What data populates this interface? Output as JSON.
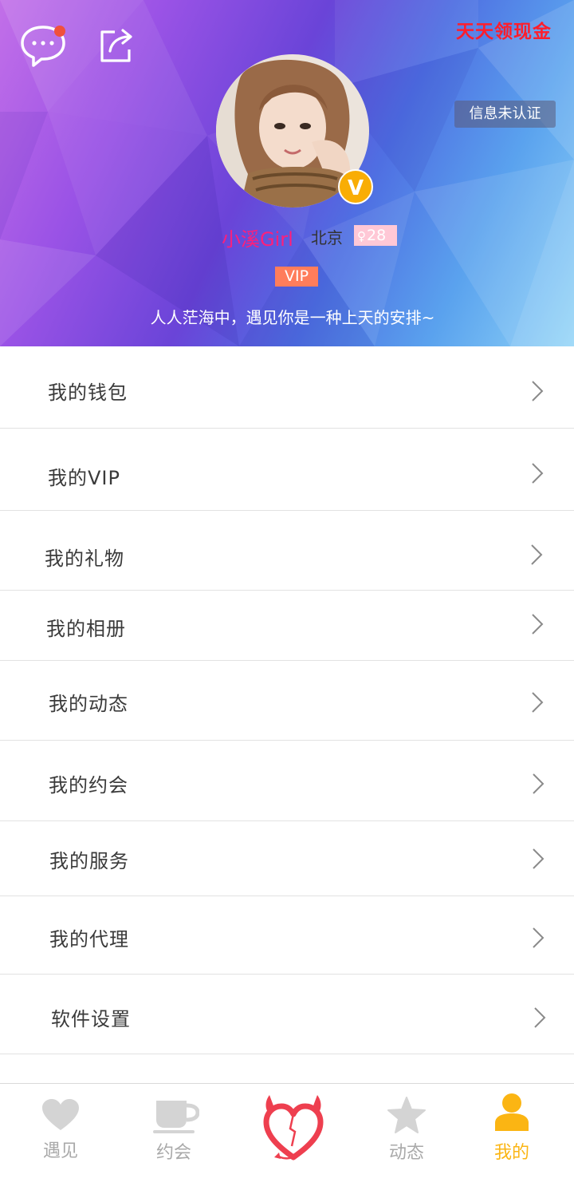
{
  "header": {
    "cash_link": "天天领现金",
    "unverified_badge": "信息未认证",
    "profile": {
      "name": "小溪Girl",
      "city": "北京",
      "gender_symbol": "♀",
      "age": "28",
      "vip_tag": "VIP",
      "verified_badge": "V",
      "bio": "人人茫海中，遇见你是一种上天的安排~"
    }
  },
  "menu": {
    "items": [
      {
        "label": "我的钱包"
      },
      {
        "label": "我的VIP"
      },
      {
        "label": "我的礼物"
      },
      {
        "label": "我的相册"
      },
      {
        "label": "我的动态"
      },
      {
        "label": "我的约会"
      },
      {
        "label": "我的服务"
      },
      {
        "label": "我的代理"
      },
      {
        "label": "软件设置"
      }
    ]
  },
  "tabbar": {
    "tabs": [
      {
        "label": "遇见",
        "icon": "heart-icon"
      },
      {
        "label": "约会",
        "icon": "coffee-cup-icon"
      },
      {
        "label": "",
        "icon": "devil-heart-icon"
      },
      {
        "label": "动态",
        "icon": "star-icon"
      },
      {
        "label": "我的",
        "icon": "person-icon",
        "active": true
      }
    ]
  },
  "colors": {
    "active_tab": "#fbb513",
    "cash_link": "#ff1e2c",
    "vip_tag": "#ff7d5b",
    "username": "#ff1f7a"
  }
}
